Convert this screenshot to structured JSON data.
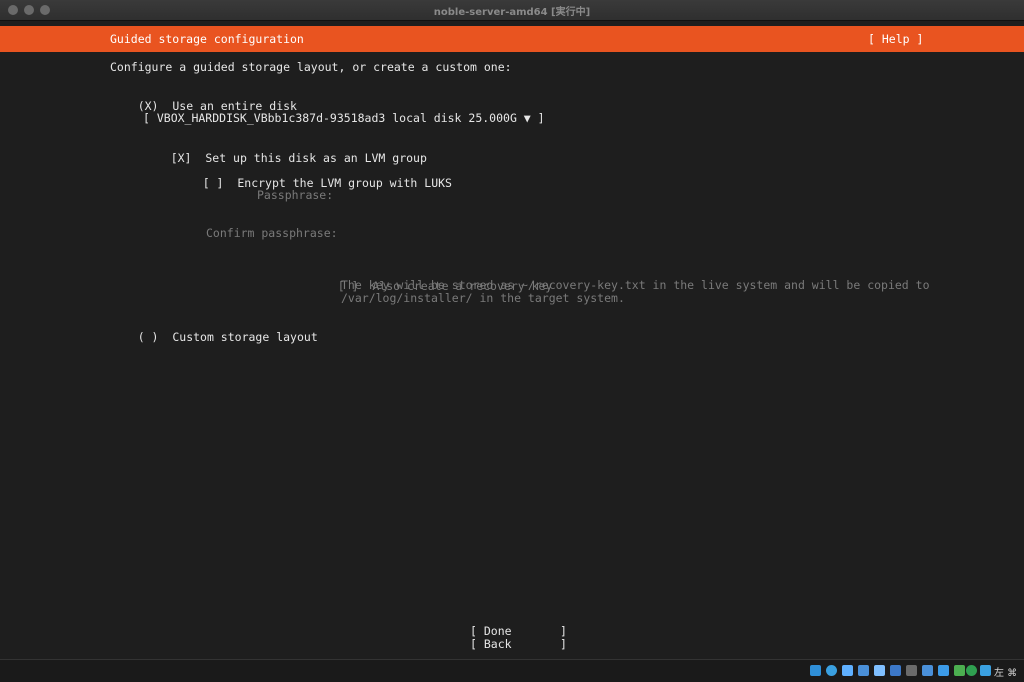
{
  "window": {
    "title": "noble-server-amd64 [実行中]"
  },
  "header": {
    "title": "Guided storage configuration",
    "help": "[ Help ]"
  },
  "intro": "Configure a guided storage layout, or create a custom one:",
  "entire_disk": {
    "radio": "(X)",
    "label": "Use an entire disk"
  },
  "disk_select": "[ VBOX_HARDDISK_VBbb1c387d-93518ad3 local disk 25.000G ▼ ]",
  "lvm": {
    "checkbox": "[X]",
    "label": "Set up this disk as an LVM group"
  },
  "encrypt": {
    "checkbox": "[ ]",
    "label": "Encrypt the LVM group with LUKS"
  },
  "passphrase_label": "Passphrase:",
  "confirm_passphrase_label": "Confirm passphrase:",
  "recovery": {
    "checkbox": "[ ]",
    "label": "Also create a recovery key",
    "desc_line1": "The key will be stored as ~/recovery-key.txt in the live system and will be copied to",
    "desc_line2": "/var/log/installer/ in the target system."
  },
  "custom_layout": {
    "radio": "( )",
    "label": "Custom storage layout"
  },
  "buttons": {
    "done": "[ Done       ]",
    "back": "[ Back       ]"
  },
  "statusbar": {
    "host_key": "左 ⌘",
    "icon_colors": [
      "#2f8fd8",
      "#3aa0e0",
      "#5fb0ff",
      "#4a90d9",
      "#7fbfff",
      "#3c78c8",
      "#6a6a6a",
      "#4a90d9",
      "#3c9be8",
      "#4caf50",
      "#2fa050",
      "#3aa0e0"
    ]
  },
  "colors": {
    "accent": "#e95420",
    "background": "#1e1e1e",
    "text": "#e6e6e6",
    "dim_text": "#7a7a7a"
  }
}
